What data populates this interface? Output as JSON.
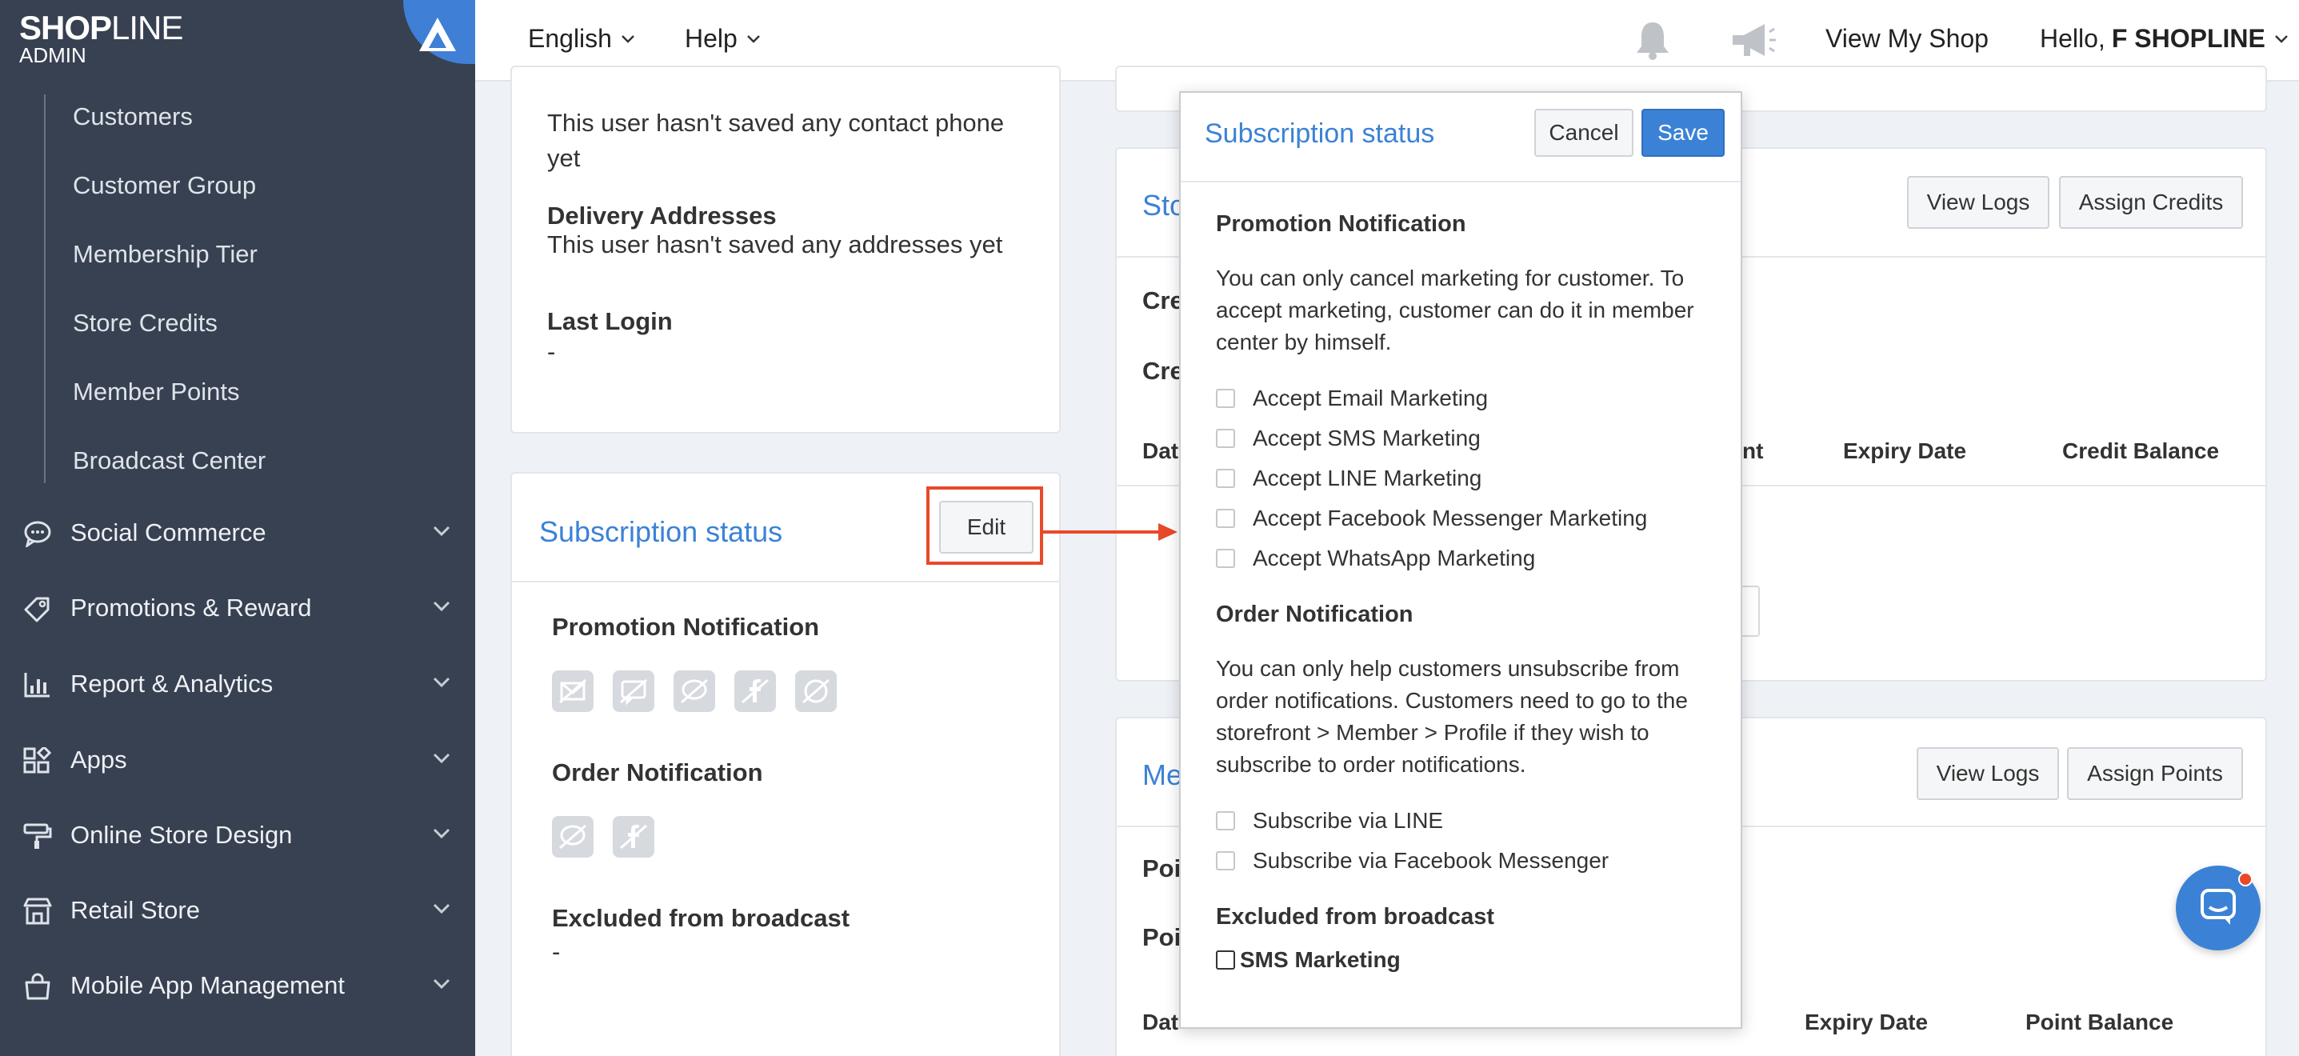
{
  "brand": {
    "name_bold": "SHOP",
    "name_thin": "LINE",
    "sub": "ADMIN"
  },
  "topbar": {
    "language": "English",
    "help": "Help",
    "view_shop": "View My Shop",
    "hello_prefix": "Hello,",
    "user_name": "F SHOPLINE"
  },
  "sidebar": {
    "sub_items": [
      "Customers",
      "Customer Group",
      "Membership Tier",
      "Store Credits",
      "Member Points",
      "Broadcast Center"
    ],
    "sections": [
      {
        "label": "Social Commerce",
        "icon": "chat-bubble-icon"
      },
      {
        "label": "Promotions & Reward",
        "icon": "tag-icon"
      },
      {
        "label": "Report & Analytics",
        "icon": "bar-chart-icon"
      },
      {
        "label": "Apps",
        "icon": "apps-grid-icon"
      },
      {
        "label": "Online Store Design",
        "icon": "paint-roller-icon"
      },
      {
        "label": "Retail Store",
        "icon": "store-icon"
      },
      {
        "label": "Mobile App Management",
        "icon": "shopping-bag-icon"
      }
    ]
  },
  "left_card": {
    "contact_phone_text": "This user hasn't saved any contact phone yet",
    "delivery_label": "Delivery Addresses",
    "delivery_text": "This user hasn't saved any addresses yet",
    "last_login_label": "Last Login",
    "last_login_value": "-"
  },
  "subscription_card": {
    "title": "Subscription status",
    "edit": "Edit",
    "promotion_label": "Promotion Notification",
    "order_label": "Order Notification",
    "excluded_label": "Excluded from broadcast",
    "excluded_value": "-"
  },
  "right_cards": {
    "credits": {
      "title_fragment": "Sto",
      "view_logs": "View Logs",
      "assign": "Assign Credits",
      "row1": "Cre",
      "row2": "Cre",
      "col_date": "Dat",
      "col_amount_fragment": "nt",
      "col_expiry": "Expiry Date",
      "col_balance": "Credit Balance"
    },
    "points": {
      "title_fragment": "Me",
      "view_logs": "View Logs",
      "assign": "Assign Points",
      "row1": "Poi",
      "row2": "Poi",
      "col_date": "Dat",
      "col_expiry": "Expiry Date",
      "col_balance": "Point Balance"
    }
  },
  "popup": {
    "title": "Subscription status",
    "cancel": "Cancel",
    "save": "Save",
    "promotion_heading": "Promotion Notification",
    "promotion_desc": "You can only cancel marketing for customer. To accept marketing, customer can do it in member center by himself.",
    "promotion_options": [
      "Accept Email Marketing",
      "Accept SMS Marketing",
      "Accept LINE Marketing",
      "Accept Facebook Messenger Marketing",
      "Accept WhatsApp Marketing"
    ],
    "order_heading": "Order Notification",
    "order_desc": "You can only help customers unsubscribe from order notifications. Customers need to go to the storefront > Member > Profile if they wish to subscribe to order notifications.",
    "order_options": [
      "Subscribe via LINE",
      "Subscribe via Facebook Messenger"
    ],
    "excluded_heading": "Excluded from broadcast",
    "excluded_option": "SMS Marketing"
  },
  "colors": {
    "sidebar": "#374151",
    "accent": "#3b82d6",
    "highlight": "#e8492a"
  }
}
